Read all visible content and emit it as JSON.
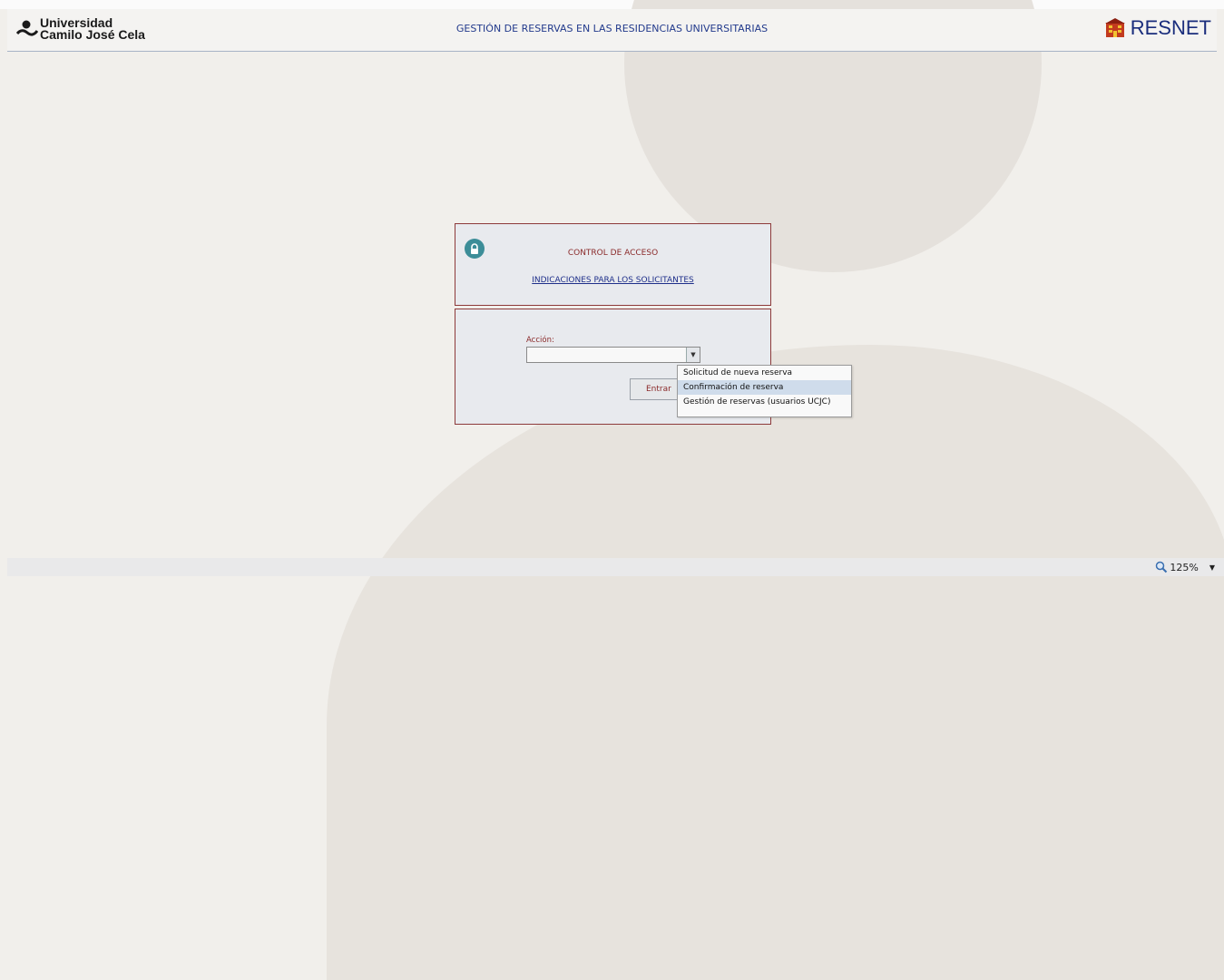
{
  "header": {
    "university_line1": "Universidad",
    "university_line2": "Camilo José Cela",
    "title": "GESTIÓN DE RESERVAS EN LAS RESIDENCIAS UNIVERSITARIAS",
    "brand": "RESNET"
  },
  "access": {
    "title": "CONTROL DE ACCESO",
    "link": "INDICACIONES PARA LOS SOLICITANTES"
  },
  "form": {
    "action_label": "Acción:",
    "action_value": "",
    "submit_label": "Entrar",
    "options": [
      "Solicitud de nueva reserva",
      "Confirmación de reserva",
      "Gestión de reservas (usuarios UCJC)"
    ],
    "highlighted_option": "Confirmación de reserva"
  },
  "statusbar": {
    "zoom": "125%"
  },
  "colors": {
    "accent_red": "#8a2a2a",
    "link_blue": "#1e2f8a",
    "lock_teal": "#3c8d98"
  }
}
